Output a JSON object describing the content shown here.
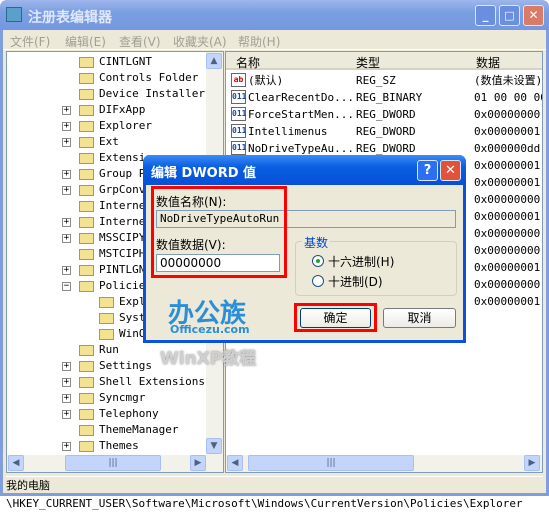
{
  "window": {
    "title": "注册表编辑器",
    "minimize": "_",
    "maximize": "□",
    "close": "✕"
  },
  "menu": [
    "文件(F)",
    "编辑(E)",
    "查看(V)",
    "收藏夹(A)",
    "帮助(H)"
  ],
  "tree": [
    {
      "label": "CINTLGNT",
      "expander": ""
    },
    {
      "label": "Controls Folder",
      "expander": ""
    },
    {
      "label": "Device Installer",
      "expander": ""
    },
    {
      "label": "DIFxApp",
      "expander": "+"
    },
    {
      "label": "Explorer",
      "expander": "+"
    },
    {
      "label": "Ext",
      "expander": "+"
    },
    {
      "label": "Extensions",
      "expander": ""
    },
    {
      "label": "Group Policy",
      "expander": "+"
    },
    {
      "label": "GrpConv",
      "expander": "+"
    },
    {
      "label": "Internet",
      "expander": ""
    },
    {
      "label": "Internet",
      "expander": "+"
    },
    {
      "label": "MSSCIPY",
      "expander": "+"
    },
    {
      "label": "MSTCIPH",
      "expander": ""
    },
    {
      "label": "PINTLGNT",
      "expander": "+"
    },
    {
      "label": "Policies",
      "expander": "-"
    },
    {
      "label": "Explorer",
      "expander": "",
      "child": true,
      "open": true
    },
    {
      "label": "System",
      "expander": "",
      "child": true
    },
    {
      "label": "WinOldApp",
      "expander": "",
      "child": true
    },
    {
      "label": "Run",
      "expander": ""
    },
    {
      "label": "Settings",
      "expander": "+"
    },
    {
      "label": "Shell Extensions",
      "expander": "+"
    },
    {
      "label": "Syncmgr",
      "expander": "+"
    },
    {
      "label": "Telephony",
      "expander": "+"
    },
    {
      "label": "ThemeManager",
      "expander": ""
    },
    {
      "label": "Themes",
      "expander": "+"
    }
  ],
  "list": {
    "headers": [
      "名称",
      "类型",
      "数据"
    ],
    "rows": [
      {
        "icon": "ab",
        "name": "(默认)",
        "type": "REG_SZ",
        "data": "(数值未设置)"
      },
      {
        "icon": "bin",
        "name": "ClearRecentDo...",
        "type": "REG_BINARY",
        "data": "01 00 00 00"
      },
      {
        "icon": "bin",
        "name": "ForceStartMen...",
        "type": "REG_DWORD",
        "data": "0x00000000"
      },
      {
        "icon": "bin",
        "name": "Intellimenus",
        "type": "REG_DWORD",
        "data": "0x00000001"
      },
      {
        "icon": "bin",
        "name": "NoDriveTypeAu...",
        "type": "REG_DWORD",
        "data": "0x000000dd"
      },
      {
        "data": "0x00000001"
      },
      {
        "data": "0x00000001"
      },
      {
        "data": "0x00000000"
      },
      {
        "data": "0x00000001"
      },
      {
        "data": "0x00000000"
      },
      {
        "data": "0x00000000"
      },
      {
        "data": "0x00000001"
      },
      {
        "data": "0x00000000"
      },
      {
        "data": "0x00000001"
      }
    ]
  },
  "status": "我的电脑\\HKEY_CURRENT_USER\\Software\\Microsoft\\Windows\\CurrentVersion\\Policies\\Explorer",
  "dialog": {
    "title": "编辑 DWORD 值",
    "help": "?",
    "close": "✕",
    "name_label": "数值名称(N):",
    "name_value": "NoDriveTypeAutoRun",
    "data_label": "数值数据(V):",
    "data_value": "00000000",
    "base_label": "基数",
    "hex_label": "十六进制(H)",
    "dec_label": "十进制(D)",
    "hex_selected": true,
    "ok": "确定",
    "cancel": "取消"
  },
  "watermark": {
    "logo": "办公族",
    "site": "Officezu.com",
    "caption": "WinXP教程"
  },
  "colors": {
    "highlight": "#ff0000",
    "title_active": "#0a5ee0"
  }
}
